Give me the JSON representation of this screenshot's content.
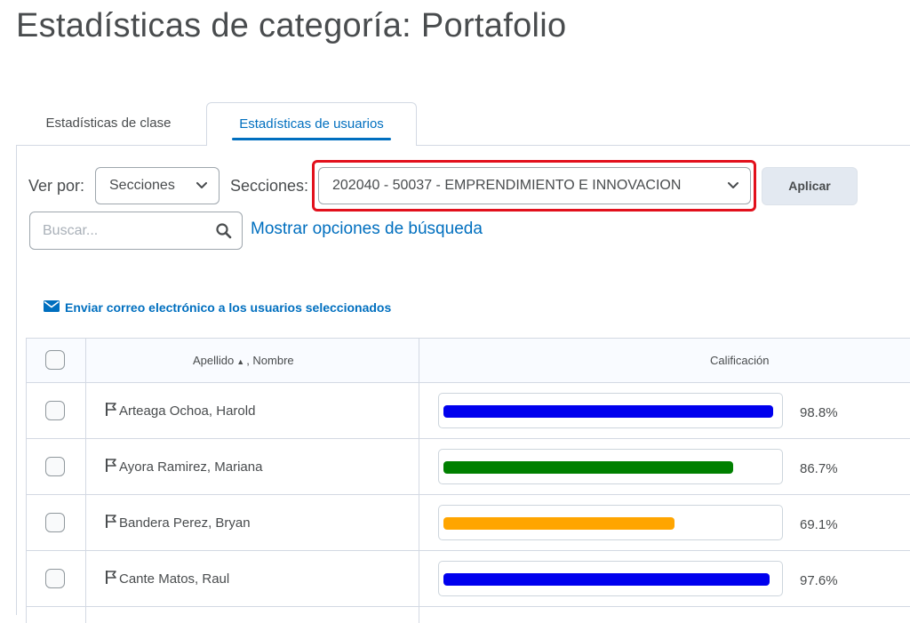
{
  "page": {
    "title": "Estadísticas de categoría: Portafolio"
  },
  "tabs": [
    {
      "label": "Estadísticas de clase",
      "active": false
    },
    {
      "label": "Estadísticas de usuarios",
      "active": true
    }
  ],
  "filters": {
    "view_by_label": "Ver por:",
    "view_by_value": "Secciones",
    "sections_label": "Secciones:",
    "sections_value": "202040 - 50037 - EMPRENDIMIENTO E INNOVACION",
    "apply_label": "Aplicar"
  },
  "search": {
    "placeholder": "Buscar...",
    "value": "",
    "options_link": "Mostrar opciones de búsqueda"
  },
  "actions": {
    "email_selected": "Enviar correo electrónico a los usuarios seleccionados"
  },
  "table": {
    "headers": {
      "last_name": "Apellido",
      "first_name": ", Nombre",
      "grade": "Calificación"
    },
    "rows": [
      {
        "name": "Arteaga Ochoa, Harold",
        "grade": "98.8%",
        "fraction": 0.988,
        "color": "#0000ee"
      },
      {
        "name": "Ayora Ramirez, Mariana",
        "grade": "86.7%",
        "fraction": 0.867,
        "color": "#008000"
      },
      {
        "name": "Bandera Perez, Bryan",
        "grade": "69.1%",
        "fraction": 0.691,
        "color": "#ffa500"
      },
      {
        "name": "Cante Matos, Raul",
        "grade": "97.6%",
        "fraction": 0.976,
        "color": "#0000ee"
      }
    ]
  },
  "colors": {
    "accent": "#006fbf",
    "highlight": "#e2101c"
  }
}
